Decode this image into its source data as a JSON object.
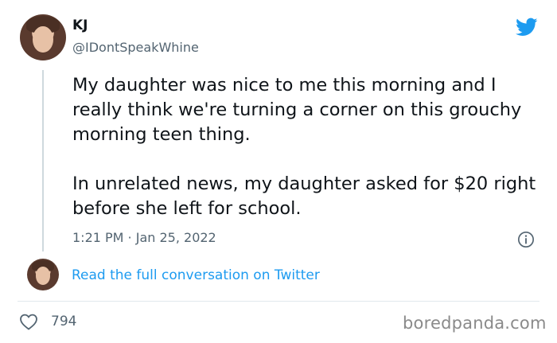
{
  "author": {
    "name": "KJ",
    "handle": "@IDontSpeakWhine",
    "avatar_icon": "profile-photo"
  },
  "brand": {
    "icon": "twitter-bird-icon",
    "color": "#1d9bf0"
  },
  "tweet": {
    "paragraphs": [
      "My daughter was nice to me this morning and I really think we're turning a corner on this grouchy morning teen thing.",
      "In unrelated news, my daughter asked for $20 right before she left for school."
    ],
    "timestamp": "1:21 PM · Jan 25, 2022"
  },
  "read_full_link": "Read the full conversation on Twitter",
  "likes": {
    "icon": "heart-icon",
    "count": "794"
  },
  "watermark": "boredpanda.com",
  "colors": {
    "text": "#0f1419",
    "secondary": "#536471",
    "link": "#1d9bf0"
  }
}
